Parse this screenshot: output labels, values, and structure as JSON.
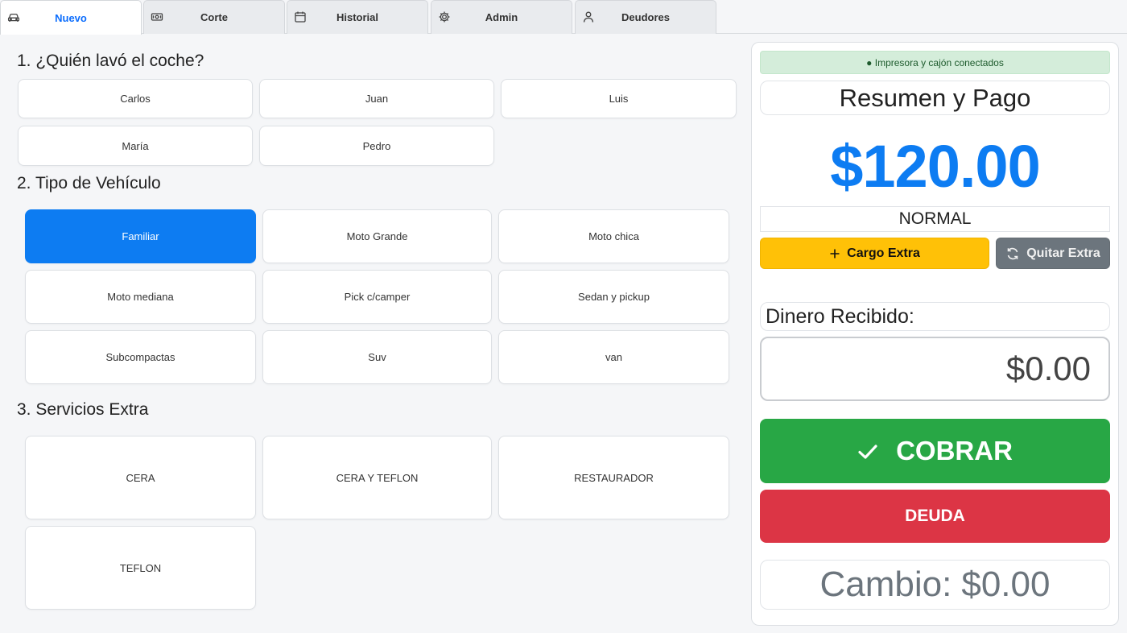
{
  "tabs": [
    {
      "label": "Nuevo",
      "icon": "car-icon",
      "active": true
    },
    {
      "label": "Corte",
      "icon": "cash-icon",
      "active": false
    },
    {
      "label": "Historial",
      "icon": "calendar-icon",
      "active": false
    },
    {
      "label": "Admin",
      "icon": "gear-icon",
      "active": false
    },
    {
      "label": "Deudores",
      "icon": "person-icon",
      "active": false
    }
  ],
  "sections": {
    "washer": {
      "title": "1. ¿Quién lavó el coche?",
      "options": [
        "Carlos",
        "Juan",
        "Luis",
        "María",
        "Pedro"
      ]
    },
    "vehicle": {
      "title": "2. Tipo de Vehículo",
      "options": [
        "Familiar",
        "Moto Grande",
        "Moto chica",
        "Moto mediana",
        "Pick c/camper",
        "Sedan y pickup",
        "Subcompactas",
        "Suv",
        "van"
      ],
      "selected": "Familiar"
    },
    "extras": {
      "title": "3. Servicios Extra",
      "options": [
        "CERA",
        "CERA Y TEFLON",
        "RESTAURADOR",
        "TEFLON"
      ]
    }
  },
  "summary": {
    "status": "● Impresora y cajón conectados",
    "title": "Resumen y Pago",
    "total": "$120.00",
    "mode": "NORMAL",
    "add_extra_label": "Cargo Extra",
    "remove_extra_label": "Quitar Extra",
    "received_label": "Dinero Recibido:",
    "received_placeholder": "$0.00",
    "charge_label": "COBRAR",
    "debt_label": "DEUDA",
    "change_label": "Cambio:",
    "change_value": "$0.00"
  },
  "colors": {
    "primary": "#0d7cf2",
    "success": "#28a745",
    "danger": "#dc3545",
    "warning": "#ffc107",
    "secondary": "#6c757d"
  }
}
